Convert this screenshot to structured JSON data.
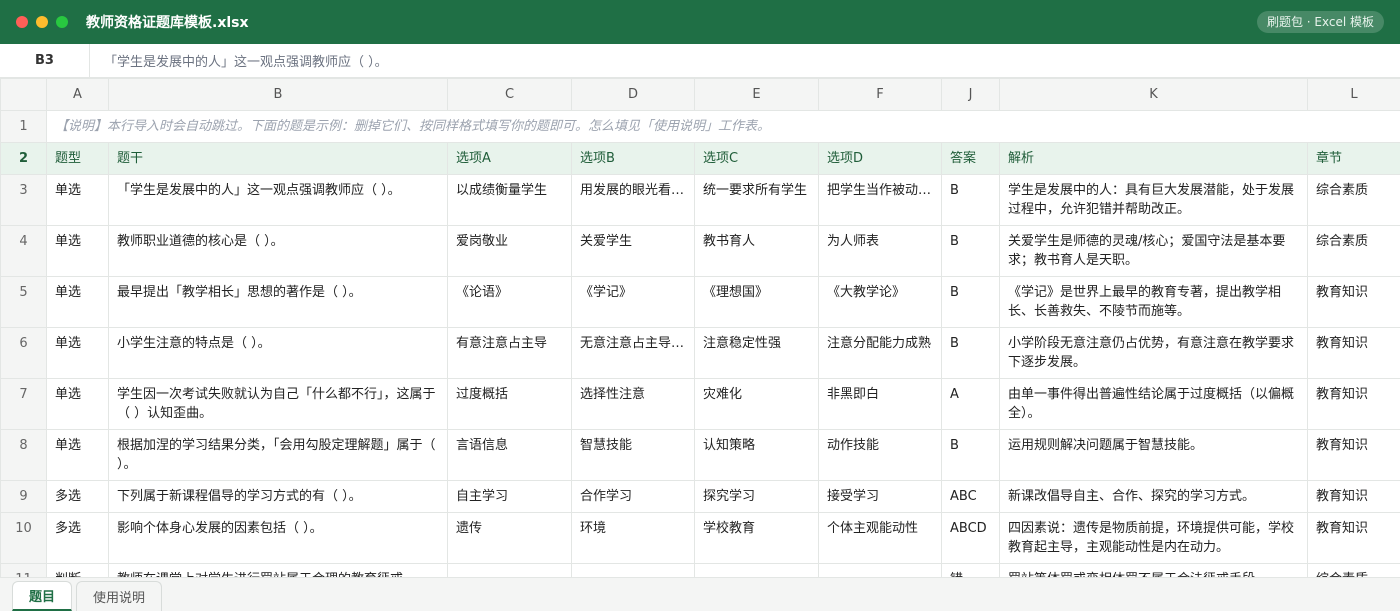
{
  "window": {
    "title": "教师资格证题库模板.xlsx",
    "badge": "刷题包 · Excel 模板",
    "controls": {
      "close_color": "#ff5f57",
      "minimize_color": "#febc2e",
      "maximize_color": "#28c840"
    }
  },
  "formula_bar": {
    "cell_ref": "B3",
    "content": "「学生是发展中的人」这一观点强调教师应（ ）。"
  },
  "columns": [
    "A",
    "B",
    "C",
    "D",
    "E",
    "F",
    "J",
    "K",
    "L"
  ],
  "note_row": {
    "row": "1",
    "text": "【说明】本行导入时会自动跳过。下面的题是示例：删掉它们、按同样格式填写你的题即可。怎么填见「使用说明」工作表。"
  },
  "header_row": {
    "row": "2",
    "cells": [
      "题型",
      "题干",
      "选项A",
      "选项B",
      "选项C",
      "选项D",
      "答案",
      "解析",
      "章节"
    ]
  },
  "rows": [
    {
      "row": "3",
      "cells": [
        "单选",
        "「学生是发展中的人」这一观点强调教师应（ ）。",
        "以成绩衡量学生",
        "用发展的眼光看…",
        "统一要求所有学生",
        "把学生当作被动…",
        "B",
        "学生是发展中的人：具有巨大发展潜能，处于发展过程中，允许犯错并帮助改正。",
        "综合素质"
      ]
    },
    {
      "row": "4",
      "cells": [
        "单选",
        "教师职业道德的核心是（ ）。",
        "爱岗敬业",
        "关爱学生",
        "教书育人",
        "为人师表",
        "B",
        "关爱学生是师德的灵魂/核心；爱国守法是基本要求；教书育人是天职。",
        "综合素质"
      ]
    },
    {
      "row": "5",
      "cells": [
        "单选",
        "最早提出「教学相长」思想的著作是（ ）。",
        "《论语》",
        "《学记》",
        "《理想国》",
        "《大教学论》",
        "B",
        "《学记》是世界上最早的教育专著，提出教学相长、长善救失、不陵节而施等。",
        "教育知识"
      ]
    },
    {
      "row": "6",
      "cells": [
        "单选",
        "小学生注意的特点是（ ）。",
        "有意注意占主导",
        "无意注意占主导…",
        "注意稳定性强",
        "注意分配能力成熟",
        "B",
        "小学阶段无意注意仍占优势，有意注意在教学要求下逐步发展。",
        "教育知识"
      ]
    },
    {
      "row": "7",
      "cells": [
        "单选",
        "学生因一次考试失败就认为自己「什么都不行」，这属于（ ）认知歪曲。",
        "过度概括",
        "选择性注意",
        "灾难化",
        "非黑即白",
        "A",
        "由单一事件得出普遍性结论属于过度概括（以偏概全）。",
        "教育知识"
      ]
    },
    {
      "row": "8",
      "cells": [
        "单选",
        "根据加涅的学习结果分类，「会用勾股定理解题」属于（ ）。",
        "言语信息",
        "智慧技能",
        "认知策略",
        "动作技能",
        "B",
        "运用规则解决问题属于智慧技能。",
        "教育知识"
      ]
    },
    {
      "row": "9",
      "cells": [
        "多选",
        "下列属于新课程倡导的学习方式的有（ ）。",
        "自主学习",
        "合作学习",
        "探究学习",
        "接受学习",
        "ABC",
        "新课改倡导自主、合作、探究的学习方式。",
        "教育知识"
      ]
    },
    {
      "row": "10",
      "cells": [
        "多选",
        "影响个体身心发展的因素包括（ ）。",
        "遗传",
        "环境",
        "学校教育",
        "个体主观能动性",
        "ABCD",
        "四因素说：遗传是物质前提，环境提供可能，学校教育起主导，主观能动性是内在动力。",
        "教育知识"
      ]
    },
    {
      "row": "11",
      "cells": [
        "判断",
        "教师在课堂上对学生进行罚站属于合理的教育惩戒。",
        "",
        "",
        "",
        "",
        "错",
        "罚站等体罚或变相体罚不属于合法惩戒手段。",
        "综合素质"
      ]
    }
  ],
  "sheet_tabs": [
    {
      "label": "题目",
      "active": true
    },
    {
      "label": "使用说明",
      "active": false
    }
  ],
  "colors": {
    "brand": "#1f6f45",
    "header_fill": "#e8f3ec",
    "gridline": "#e3e6e4"
  }
}
